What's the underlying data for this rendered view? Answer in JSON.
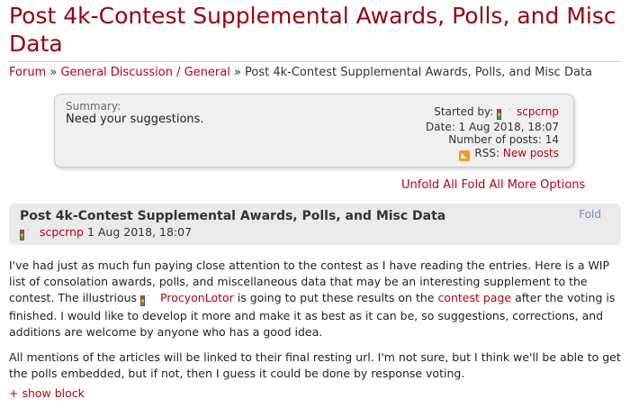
{
  "page": {
    "title": "Post 4k-Contest Supplemental Awards, Polls, and Misc Data"
  },
  "breadcrumb": {
    "forum": "Forum",
    "sep1": " » ",
    "category": "General Discussion / General",
    "sep2": " » ",
    "current": "Post 4k-Contest Supplemental Awards, Polls, and Misc Data"
  },
  "summary": {
    "label": "Summary:",
    "text": "Need your suggestions.",
    "started_by_label": "Started by:",
    "started_by_user": "scpcrnp",
    "date": "Date: 1 Aug 2018, 18:07",
    "posts": "Number of posts: 14",
    "rss_label": "RSS:",
    "rss_link": "New posts"
  },
  "options": {
    "unfold": "Unfold All",
    "fold": "Fold All",
    "more": "More Options"
  },
  "post": {
    "title": "Post 4k-Contest Supplemental Awards, Polls, and Misc Data",
    "fold_label": "Fold",
    "author": "scpcrnp",
    "date": "1 Aug 2018, 18:07",
    "p1_a": "I've had just as much fun paying close attention to the contest as I have reading the entries. Here is a WIP list of consolation awards, polls, and miscellaneous data that may be an interesting supplement to the contest. The illustrious ",
    "p1_user": "ProcyonLotor",
    "p1_b": " is going to put these results on the ",
    "p1_link": "contest page",
    "p1_c": " after the voting is finished. I would like to develop it more and make it as best as it can be, so suggestions, corrections, and additions are welcome by anyone who has a good idea.",
    "p2": "All mentions of the articles will be linked to their final resting url. I'm not sure, but I think we'll be able to get the polls embedded, but if not, then I guess it could be done by response voting.",
    "show_block": "+ show block"
  },
  "colors": {
    "title": "#990011",
    "link": "#bb0011",
    "fold": "#7788bb",
    "summary_bg": "#f0f0f0",
    "post_header_bg": "#eaeaea"
  }
}
